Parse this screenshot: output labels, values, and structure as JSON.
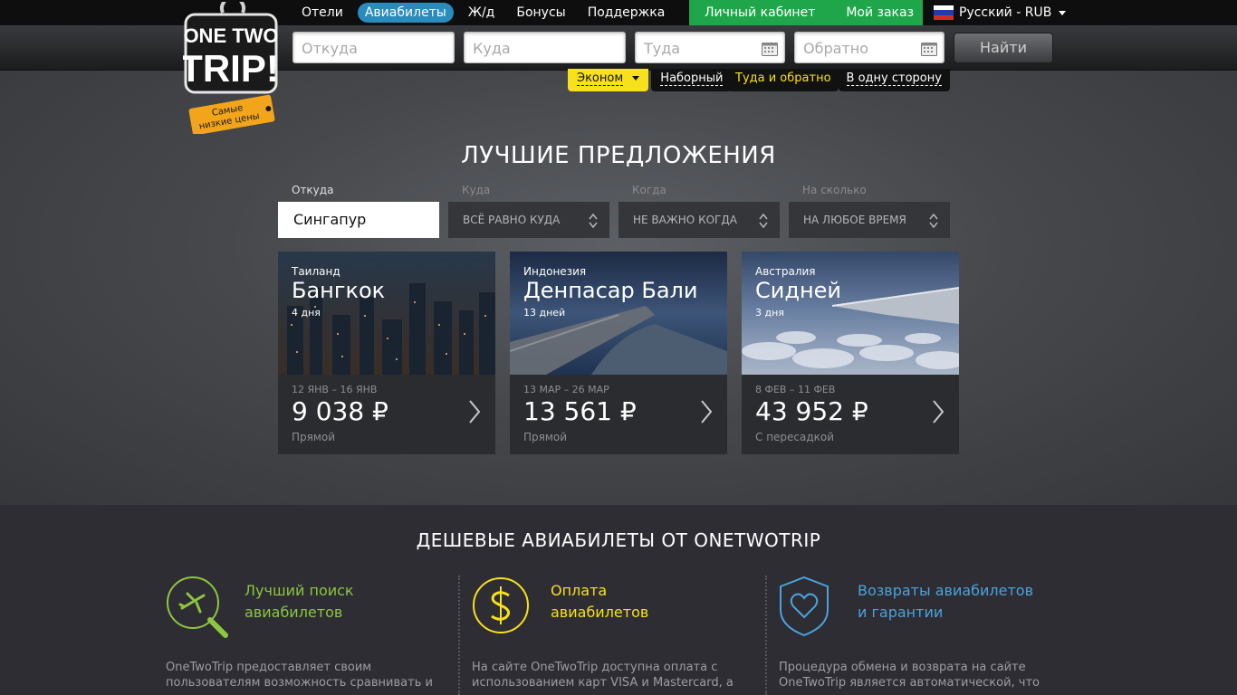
{
  "nav": {
    "items": [
      {
        "label": "Отели",
        "active": false
      },
      {
        "label": "Авиабилеты",
        "active": true
      },
      {
        "label": "Ж/д",
        "active": false
      },
      {
        "label": "Бонусы",
        "active": false
      },
      {
        "label": "Поддержка",
        "active": false
      }
    ],
    "account_label": "Личный кабинет",
    "order_label": "Мой заказ",
    "language_label": "Русский - RUB"
  },
  "logo": {
    "line1": "ONE TWO",
    "line2": "TRIP!",
    "tag_line1": "Самые",
    "tag_line2": "низкие цены"
  },
  "search": {
    "from_placeholder": "Откуда",
    "to_placeholder": "Куда",
    "depart_placeholder": "Туда",
    "return_placeholder": "Обратно",
    "find_label": "Найти"
  },
  "filters": {
    "class_label": "Эконом",
    "multi_label": "Наборный",
    "roundtrip_label": "Туда и обратно",
    "oneway_label": "В одну сторону"
  },
  "offers": {
    "title": "ЛУЧШИЕ ПРЕДЛОЖЕНИЯ",
    "from_label": "Откуда",
    "from_value": "Сингапур",
    "to_label": "Куда",
    "to_value": "ВСЁ РАВНО КУДА",
    "when_label": "Когда",
    "when_value": "НЕ ВАЖНО КОГДА",
    "duration_label": "На сколько",
    "duration_value": "НА ЛЮБОЕ ВРЕМЯ",
    "cards": [
      {
        "country": "Таиланд",
        "city": "Бангкок",
        "days": "4 дня",
        "dates": "12 ЯНВ – 16 ЯНВ",
        "price": "9 038 ₽",
        "type": "Прямой"
      },
      {
        "country": "Индонезия",
        "city": "Денпасар Бали",
        "days": "13 дней",
        "dates": "13 МАР – 26 МАР",
        "price": "13 561 ₽",
        "type": "Прямой"
      },
      {
        "country": "Австралия",
        "city": "Сидней",
        "days": "3 дня",
        "dates": "8 ФЕВ – 11 ФЕВ",
        "price": "43 952 ₽",
        "type": "С пересадкой"
      }
    ]
  },
  "features": {
    "title": "ДЕШЕВЫЕ АВИАБИЛЕТЫ ОТ ONETWOTRIP",
    "items": [
      {
        "title_line1": "Лучший поиск",
        "title_line2": "авиабилетов",
        "color": "#8dc63f",
        "text_line1": "OneTwoTrip предоставляет своим",
        "text_line2": "пользователям возможность сравнивать и"
      },
      {
        "title_line1": "Оплата",
        "title_line2": "авиабилетов",
        "color": "#f7e11a",
        "text_line1": "На сайте OneTwoTrip доступна оплата с",
        "text_line2": "использованием карт VISA и Mastercard, а"
      },
      {
        "title_line1": "Возвраты авиабилетов",
        "title_line2": "и гарантии",
        "color": "#4aa3df",
        "text_line1": "Процедура обмена и возврата на сайте",
        "text_line2": "OneTwoTrip является автоматической, что"
      }
    ]
  },
  "colors": {
    "nav_active": "#2a8bbd",
    "account_green": "#1fa64a",
    "filter_yellow": "#f7e11a"
  }
}
